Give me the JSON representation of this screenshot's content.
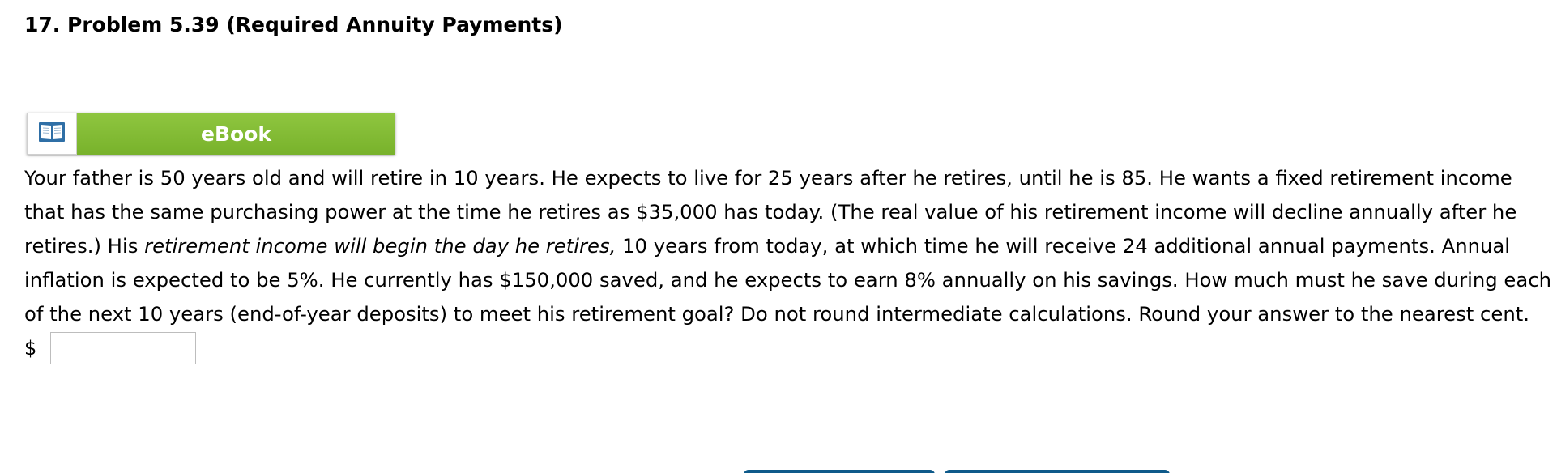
{
  "question": {
    "title": "17.  Problem 5.39 (Required Annuity Payments)",
    "ebook_label": "eBook",
    "text_part1": "Your father is 50 years old and will retire in 10 years. He expects to live for 25 years after he retires, until he is 85. He wants a fixed retirement income that has the same purchasing power at the time he retires as $35,000 has today. (The real value of his retirement income will decline annually after he retires.) His ",
    "text_italic": "retirement income will begin the day he retires,",
    "text_part2": " 10 years from today, at which time he will receive 24 additional annual payments. Annual inflation is expected to be 5%. He currently has $150,000 saved, and he expects to earn 8% annually on his savings. How much must he save during each of the next 10 years (end-of-year deposits) to meet his retirement goal? Do not round intermediate calculations. Round your answer to the nearest cent."
  },
  "answer": {
    "currency_symbol": "$",
    "value": ""
  },
  "icons": {
    "ebook": "open-book-icon"
  },
  "colors": {
    "ebook_green": "#82bc36",
    "nav_blue": "#0e5a8a"
  }
}
